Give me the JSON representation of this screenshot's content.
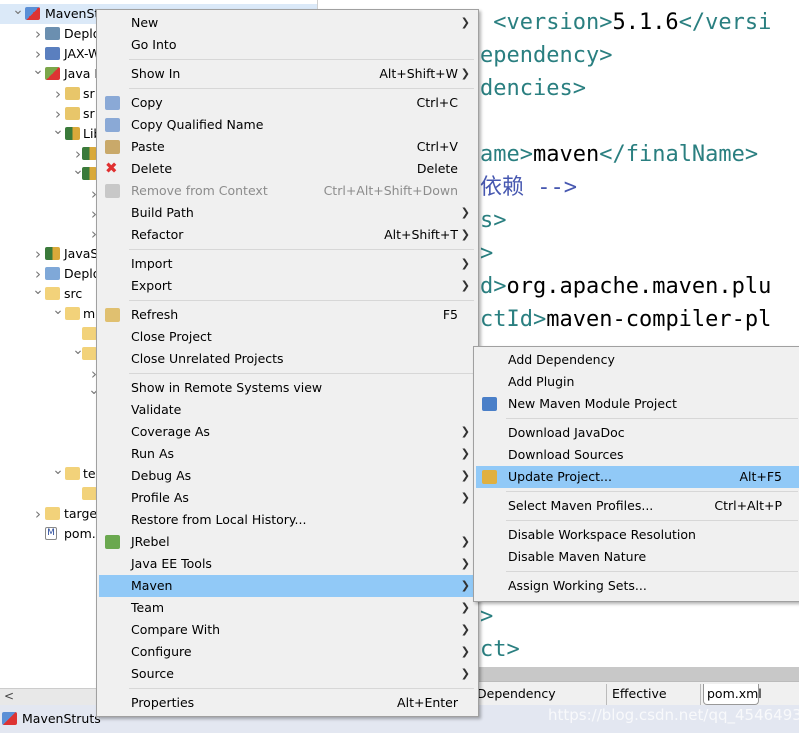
{
  "tree": {
    "rows": [
      {
        "label": "MavenStruts",
        "level": 0,
        "state": "expanded",
        "icon": "maven-project-icon",
        "selected": true
      },
      {
        "label": "Deplo",
        "level": 1,
        "state": "collapsed",
        "icon": "deployment-descriptor-icon"
      },
      {
        "label": "JAX-W",
        "level": 1,
        "state": "collapsed",
        "icon": "jax-ws-icon"
      },
      {
        "label": "Java I",
        "level": 1,
        "state": "expanded",
        "icon": "java-resources-icon"
      },
      {
        "label": "sr",
        "level": 2,
        "state": "collapsed",
        "icon": "source-folder-icon"
      },
      {
        "label": "sr",
        "level": 2,
        "state": "collapsed",
        "icon": "source-folder-icon"
      },
      {
        "label": "Lib",
        "level": 2,
        "state": "expanded",
        "icon": "library-icon"
      },
      {
        "label": "",
        "level": 3,
        "state": "collapsed",
        "icon": "library-icon"
      },
      {
        "label": "",
        "level": 3,
        "state": "expanded",
        "icon": "library-icon"
      },
      {
        "label": "",
        "level": 4,
        "state": "collapsed",
        "icon": ""
      },
      {
        "label": "",
        "level": 4,
        "state": "collapsed",
        "icon": ""
      },
      {
        "label": "",
        "level": 4,
        "state": "collapsed",
        "icon": ""
      },
      {
        "label": "JavaS",
        "level": 1,
        "state": "collapsed",
        "icon": "library-icon"
      },
      {
        "label": "Deplo",
        "level": 1,
        "state": "collapsed",
        "icon": "deployed-resources-icon"
      },
      {
        "label": "src",
        "level": 1,
        "state": "expanded",
        "icon": "folder-icon"
      },
      {
        "label": "m",
        "level": 2,
        "state": "expanded",
        "icon": "folder-icon"
      },
      {
        "label": "",
        "level": 3,
        "state": "none",
        "icon": "folder-icon"
      },
      {
        "label": "",
        "level": 3,
        "state": "expanded",
        "icon": "folder-icon"
      },
      {
        "label": "",
        "level": 4,
        "state": "collapsed",
        "icon": ""
      },
      {
        "label": "",
        "level": 4,
        "state": "expanded",
        "icon": ""
      },
      {
        "label": "",
        "level": 4,
        "state": "blank",
        "icon": ""
      },
      {
        "label": "",
        "level": 4,
        "state": "blank",
        "icon": ""
      },
      {
        "label": "",
        "level": 4,
        "state": "blank",
        "icon": ""
      },
      {
        "label": "te",
        "level": 2,
        "state": "expanded",
        "icon": "folder-icon"
      },
      {
        "label": "",
        "level": 3,
        "state": "none",
        "icon": "folder-icon"
      },
      {
        "label": "targe",
        "level": 1,
        "state": "collapsed",
        "icon": "folder-icon"
      },
      {
        "label": "pom.",
        "level": 1,
        "state": "none",
        "icon": "pom-file-icon"
      }
    ],
    "scroll_left": "<"
  },
  "status": {
    "label": "MavenStruts"
  },
  "editor": {
    "lines": [
      {
        "tag": " <version>",
        "val": "5.1.6",
        "tag2": "</versi"
      },
      {
        "tag": "ependency>"
      },
      {
        "tag": "dencies>"
      },
      {
        "tag": ""
      },
      {
        "tag": "ame>",
        "val": "maven",
        "tag2": "</finalName>"
      },
      {
        "comment": "依赖 -->"
      },
      {
        "tag": "s>"
      },
      {
        "tag": ">"
      },
      {
        "tag": "d>",
        "val": "org.apache.maven.plu"
      },
      {
        "tag": "ctId>",
        "val": "maven-compiler-pl"
      }
    ],
    "tail_lines": [
      ">",
      "ct>"
    ],
    "tabs": [
      "Dependency Hierarchy",
      "Effective POM",
      "pom.xml"
    ],
    "active_tab": "pom.xml"
  },
  "watermark": "https://blog.csdn.net/qq_45464930",
  "context_menu": {
    "items": [
      {
        "label": "New",
        "submenu": true
      },
      {
        "label": "Go Into"
      },
      {
        "sep": true
      },
      {
        "label": "Show In",
        "shortcut": "Alt+Shift+W",
        "submenu": true
      },
      {
        "sep": true
      },
      {
        "label": "Copy",
        "shortcut": "Ctrl+C",
        "icon": "copy-icon"
      },
      {
        "label": "Copy Qualified Name",
        "icon": "copy-qualified-name-icon"
      },
      {
        "label": "Paste",
        "shortcut": "Ctrl+V",
        "icon": "paste-icon"
      },
      {
        "label": "Delete",
        "shortcut": "Delete",
        "icon": "delete-icon"
      },
      {
        "label": "Remove from Context",
        "shortcut": "Ctrl+Alt+Shift+Down",
        "disabled": true,
        "icon": "remove-context-icon"
      },
      {
        "label": "Build Path",
        "submenu": true
      },
      {
        "label": "Refactor",
        "shortcut": "Alt+Shift+T",
        "submenu": true
      },
      {
        "sep": true
      },
      {
        "label": "Import",
        "submenu": true
      },
      {
        "label": "Export",
        "submenu": true
      },
      {
        "sep": true
      },
      {
        "label": "Refresh",
        "shortcut": "F5",
        "icon": "refresh-icon"
      },
      {
        "label": "Close Project"
      },
      {
        "label": "Close Unrelated Projects"
      },
      {
        "sep": true
      },
      {
        "label": "Show in Remote Systems view"
      },
      {
        "label": "Validate"
      },
      {
        "label": "Coverage As",
        "submenu": true
      },
      {
        "label": "Run As",
        "submenu": true
      },
      {
        "label": "Debug As",
        "submenu": true
      },
      {
        "label": "Profile As",
        "submenu": true
      },
      {
        "label": "Restore from Local History..."
      },
      {
        "label": "JRebel",
        "submenu": true,
        "icon": "jrebel-icon"
      },
      {
        "label": "Java EE Tools",
        "submenu": true
      },
      {
        "label": "Maven",
        "submenu": true,
        "highlighted": true
      },
      {
        "label": "Team",
        "submenu": true
      },
      {
        "label": "Compare With",
        "submenu": true
      },
      {
        "label": "Configure",
        "submenu": true
      },
      {
        "label": "Source",
        "submenu": true
      },
      {
        "sep": true
      },
      {
        "label": "Properties",
        "shortcut": "Alt+Enter"
      }
    ]
  },
  "maven_submenu": {
    "items": [
      {
        "label": "Add Dependency"
      },
      {
        "label": "Add Plugin"
      },
      {
        "label": "New Maven Module Project",
        "icon": "new-maven-module-icon"
      },
      {
        "sep": true
      },
      {
        "label": "Download JavaDoc"
      },
      {
        "label": "Download Sources"
      },
      {
        "label": "Update Project...",
        "shortcut": "Alt+F5",
        "highlighted": true,
        "icon": "update-project-icon"
      },
      {
        "sep": true
      },
      {
        "label": "Select Maven Profiles...",
        "shortcut": "Ctrl+Alt+P"
      },
      {
        "sep": true
      },
      {
        "label": "Disable Workspace Resolution"
      },
      {
        "label": "Disable Maven Nature"
      },
      {
        "sep": true
      },
      {
        "label": "Assign Working Sets..."
      }
    ]
  },
  "colors": {
    "highlight": "#91c9f7",
    "selection": "#dbe9f8",
    "xml_tag": "#2a7f80",
    "comment": "#4657b0",
    "menu_bg": "#f0f0f0"
  }
}
